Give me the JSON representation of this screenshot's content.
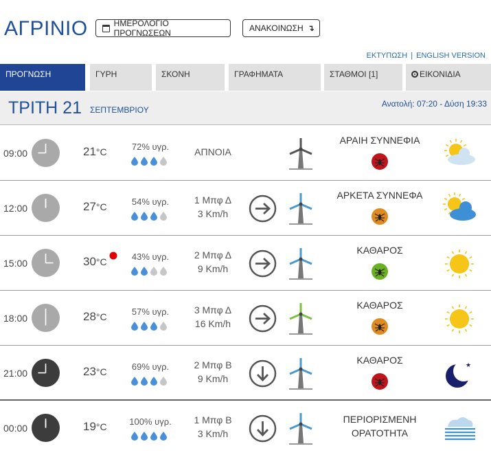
{
  "header": {
    "city": "ΑΓΡΙΝΙΟ",
    "calendar_button": "ΗΜΕΡΟΛΟΓΙΟ ΠΡΟΓΝΩΣΕΩΝ",
    "announcement_button": "ΑΝΑΚΟΙΝΩΣΗ",
    "announcement_arrow": "↴",
    "print_link": "ΕΚΤΥΠΩΣΗ",
    "link_separator": "|",
    "english_link": "ENGLISH VERSION"
  },
  "tabs": [
    {
      "label": "ΠΡΟΓΝΩΣΗ",
      "active": true
    },
    {
      "label": "ΓΥΡΗ"
    },
    {
      "label": "ΣΚΟΝΗ"
    },
    {
      "label": "ΓΡΑΦΗΜΑΤΑ"
    },
    {
      "label": "ΣΤΑΘΜΟΙ [1]"
    },
    {
      "label": "ΕΙΚΟΝΙΔΙΑ"
    }
  ],
  "day": {
    "name": "ΤΡΙΤΗ 21",
    "month": "ΣΕΠΤΕΜΒΡΙΟΥ",
    "sun_times": "Ανατολή: 07:20 - Δύση 19:33"
  },
  "colors": {
    "brand_blue": "#1f4f99",
    "active_tab": "#1f4594",
    "drop_full": "#4a90d9",
    "drop_empty": "#c6c6c6",
    "bug_red": "#c0141b",
    "bug_orange": "#e08a1f",
    "bug_green": "#6ab023",
    "hot_dot": "#e00000"
  },
  "rows": [
    {
      "time": "09:00",
      "hour": 9,
      "dark": false,
      "temp": "21",
      "deg": "°C",
      "hot": false,
      "humidity": "72% υγρ.",
      "drops_filled": 3,
      "wind_line1": "ΑΠΝΟΙΑ",
      "wind_line2": "",
      "arrow": "none",
      "turbine": "static",
      "cond_line1": "ΑΡΑΙΗ ΣΥΝΝΕΦΙΑ",
      "cond_line2": "",
      "bug": "red",
      "icon": "sun-light-cloud-icon"
    },
    {
      "time": "12:00",
      "hour": 12,
      "dark": false,
      "temp": "27",
      "deg": "°C",
      "hot": false,
      "humidity": "54% υγρ.",
      "drops_filled": 3,
      "wind_line1": "1 Μπφ Δ",
      "wind_line2": "3 Km/h",
      "arrow": "right",
      "turbine": "blue",
      "cond_line1": "ΑΡΚΕΤΑ ΣΥΝΝΕΦΑ",
      "cond_line2": "",
      "bug": "orange",
      "icon": "sun-clouds-icon"
    },
    {
      "time": "15:00",
      "hour": 15,
      "dark": false,
      "temp": "30",
      "deg": "°C",
      "hot": true,
      "humidity": "43% υγρ.",
      "drops_filled": 2,
      "wind_line1": "2 Μπφ Δ",
      "wind_line2": "9 Km/h",
      "arrow": "right",
      "turbine": "blue",
      "cond_line1": "ΚΑΘΑΡΟΣ",
      "cond_line2": "",
      "bug": "green",
      "icon": "sun-icon"
    },
    {
      "time": "18:00",
      "hour": 18,
      "dark": false,
      "temp": "28",
      "deg": "°C",
      "hot": false,
      "humidity": "57% υγρ.",
      "drops_filled": 3,
      "wind_line1": "3 Μπφ Δ",
      "wind_line2": "16 Km/h",
      "arrow": "right",
      "turbine": "green",
      "cond_line1": "ΚΑΘΑΡΟΣ",
      "cond_line2": "",
      "bug": "orange",
      "icon": "sun-icon"
    },
    {
      "time": "21:00",
      "hour": 21,
      "dark": true,
      "temp": "23",
      "deg": "°C",
      "hot": false,
      "humidity": "69% υγρ.",
      "drops_filled": 3,
      "wind_line1": "2 Μπφ Β",
      "wind_line2": "9 Km/h",
      "arrow": "down",
      "turbine": "blue",
      "cond_line1": "ΚΑΘΑΡΟΣ",
      "cond_line2": "",
      "bug": "red",
      "icon": "moon-icon"
    },
    {
      "time": "00:00",
      "hour": 0,
      "dark": true,
      "temp": "19",
      "deg": "°C",
      "hot": false,
      "humidity": "100% υγρ.",
      "drops_filled": 4,
      "wind_line1": "1 Μπφ Β",
      "wind_line2": "3 Km/h",
      "arrow": "down",
      "turbine": "blue",
      "cond_line1": "ΠΕΡΙΟΡΙΣΜΕΝΗ",
      "cond_line2": "ΟΡΑΤΟΤΗΤΑ",
      "bug": "none",
      "icon": "fog-icon"
    }
  ]
}
